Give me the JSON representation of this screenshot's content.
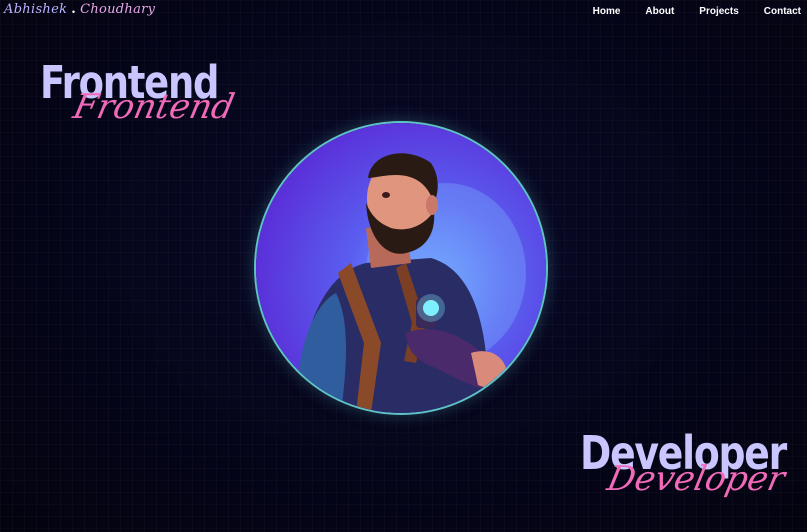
{
  "header": {
    "logo": {
      "first": "Abhishek",
      "dot": ".",
      "last": "Choudhary"
    },
    "nav": [
      {
        "label": "Home"
      },
      {
        "label": "About"
      },
      {
        "label": "Projects"
      },
      {
        "label": "Contact"
      }
    ]
  },
  "hero": {
    "top_word": {
      "main": "Frontend",
      "script": "Frontend"
    },
    "bottom_word": {
      "main": "Developer",
      "script": "Developer"
    }
  },
  "colors": {
    "background": "#05051a",
    "title_main": "#c9c6ff",
    "title_script": "#f06ab8",
    "avatar_ring": "#5ec3c6"
  }
}
